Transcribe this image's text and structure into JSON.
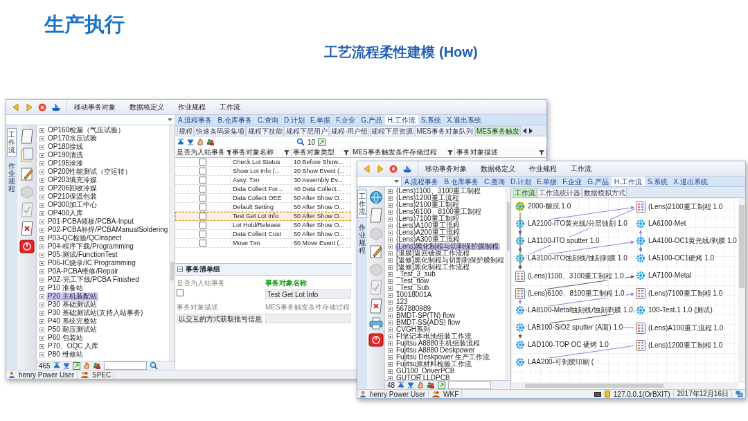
{
  "title": "生产执行",
  "subtitle": "工艺流程柔性建模 (How)",
  "windows": [
    {
      "kind": "spec",
      "menu": [
        "移动事务对象",
        "数据格定义",
        "作业规程",
        "工作流"
      ],
      "tabs": [
        {
          "label": "A.流程事务",
          "selected": false
        },
        {
          "label": "B.仓库事务",
          "selected": false
        },
        {
          "label": "C.查询",
          "selected": false
        },
        {
          "label": "D.计划",
          "selected": false
        },
        {
          "label": "E.单据",
          "selected": false
        },
        {
          "label": "F.企业",
          "selected": false
        },
        {
          "label": "G.产品",
          "selected": false
        },
        {
          "label": "H.工作流",
          "selected": true
        },
        {
          "label": "S.系统",
          "selected": false
        },
        {
          "label": "X.退出系统",
          "selected": false
        }
      ],
      "side_tabs": [
        {
          "label": "工作流",
          "selected": true
        },
        {
          "label": "作业规程",
          "selected": false
        }
      ],
      "tree": {
        "count": "465",
        "items": [
          {
            "label": "OP160检漏（气压试验）",
            "selected": false
          },
          {
            "label": "OP170水压试验",
            "selected": false
          },
          {
            "label": "OP180接线",
            "selected": false
          },
          {
            "label": "OP190清洗",
            "selected": false
          },
          {
            "label": "OP195涂漆",
            "selected": false
          },
          {
            "label": "OP200性能测试（空运转）",
            "selected": false
          },
          {
            "label": "OP203填充冷媒",
            "selected": false
          },
          {
            "label": "OP206回收冷媒",
            "selected": false
          },
          {
            "label": "OP210保温包装",
            "selected": false
          },
          {
            "label": "OP300加工中心",
            "selected": false
          },
          {
            "label": "OP400入库",
            "selected": false
          },
          {
            "label": "P01-PCBA领板/PCBA-Input",
            "selected": false
          },
          {
            "label": "P02-PCBA补焊/PCBAManualSoldering",
            "selected": false
          },
          {
            "label": "P03-QC检验/QCInspect",
            "selected": false
          },
          {
            "label": "P04-程序下载/Programming",
            "selected": false
          },
          {
            "label": "P05-测试/FunctionTest",
            "selected": false
          },
          {
            "label": "P06-IC烧录/IC Programming",
            "selected": false
          },
          {
            "label": "P0A-PCBA维修/Repair",
            "selected": false
          },
          {
            "label": "P0Z-完工下线/PCBA Finished",
            "selected": false
          },
          {
            "label": "P10 准备站",
            "selected": false
          },
          {
            "label": "P20 主机装配站",
            "selected": true
          },
          {
            "label": "P30 基础测试站",
            "selected": false
          },
          {
            "label": "P30 基础测试站(支持入站事务)",
            "selected": false
          },
          {
            "label": "P40 系统完整站",
            "selected": false
          },
          {
            "label": "P50 耐压测试站",
            "selected": false
          },
          {
            "label": "P60 包装站",
            "selected": false
          },
          {
            "label": "P70、OQC 入库",
            "selected": false
          },
          {
            "label": "P80 维修站",
            "selected": false
          }
        ]
      },
      "subtabs": [
        {
          "label": "规程",
          "selected": false
        },
        {
          "label": "快速条码采集项",
          "selected": false
        },
        {
          "label": "规程下技能",
          "selected": false
        },
        {
          "label": "规程下层用户",
          "selected": false
        },
        {
          "label": "规程-用户组",
          "selected": false
        },
        {
          "label": "规程下层资源",
          "selected": false
        },
        {
          "label": "MES事务对象队列",
          "selected": false
        },
        {
          "label": "MES事务触发",
          "selected": true
        }
      ],
      "page_size": "10",
      "table": {
        "columns": [
          "是否为入站事务",
          "事务对象名称",
          "事务对象类型",
          "MES事务触发条件存储过程",
          "事务对象描述"
        ],
        "rows": [
          {
            "inbound": false,
            "name": "Check Lot Status",
            "type": "10 Before Show...",
            "selected": false
          },
          {
            "inbound": false,
            "name": "Show Lot Info (...",
            "type": "20 Show Event (...",
            "selected": false
          },
          {
            "inbound": false,
            "name": "Assy. Txn",
            "type": "30 Assembly Ev...",
            "selected": false
          },
          {
            "inbound": false,
            "name": "Data Collect For...",
            "type": "40 Data Collect...",
            "selected": false
          },
          {
            "inbound": false,
            "name": "Data Collect OEE",
            "type": "50 After Show O...",
            "selected": false
          },
          {
            "inbound": false,
            "name": "Default Setting",
            "type": "50 After Show O...",
            "selected": false
          },
          {
            "inbound": false,
            "name": "Test Get Lot Info",
            "type": "50 After Show O...",
            "selected": true
          },
          {
            "inbound": false,
            "name": "Lot Hold/Release",
            "type": "50 After Show O...",
            "selected": false
          },
          {
            "inbound": false,
            "name": "Data Collect Cust",
            "type": "50 After Show O...",
            "selected": false
          },
          {
            "inbound": false,
            "name": "Move Txn",
            "type": "60 Move Event (...",
            "selected": false
          }
        ]
      },
      "detail": {
        "title": "事务清单组",
        "fields": [
          {
            "label": "是否为入站事务",
            "kind": "checkbox",
            "checked": false,
            "highlight": false
          },
          {
            "label": "事务对象名称",
            "kind": "text",
            "value": "Test Get Lot Info",
            "highlight": true
          },
          {
            "label": "事务对象描述",
            "kind": "text",
            "value": "以交互的方式获取批号信息",
            "highlight": false
          },
          {
            "label": "MES事务触发条件存储过程",
            "kind": "text",
            "highlight": false
          }
        ]
      },
      "status": {
        "user": "henry Power User",
        "module": "SPEC"
      }
    },
    {
      "kind": "flow",
      "menu": [
        "移动事务对象",
        "数据格定义",
        "作业规程",
        "工作流"
      ],
      "tabs": [
        {
          "label": "A.流程事务",
          "selected": false
        },
        {
          "label": "B.仓库事务",
          "selected": false
        },
        {
          "label": "C.查询",
          "selected": false
        },
        {
          "label": "D.计划",
          "selected": false
        },
        {
          "label": "E.单据",
          "selected": false
        },
        {
          "label": "F.企业",
          "selected": false
        },
        {
          "label": "G.产品",
          "selected": false
        },
        {
          "label": "H.工作流",
          "selected": true
        },
        {
          "label": "S.系统",
          "selected": false
        },
        {
          "label": "X.退出系统",
          "selected": false
        }
      ],
      "side_tabs": [
        {
          "label": "工作流",
          "selected": true
        },
        {
          "label": "作业规程",
          "selected": false
        }
      ],
      "tree": {
        "count": "48",
        "items": [
          {
            "label": "(Lens)1100、3100重工制程",
            "selected": false
          },
          {
            "label": "(Lens)1200重工流程",
            "selected": false
          },
          {
            "label": "(Lens)2100重工制程",
            "selected": false
          },
          {
            "label": "(Lens)6100、8100重工制程",
            "selected": false
          },
          {
            "label": "(Lens)7100重工制程",
            "selected": false
          },
          {
            "label": "(Lens)A100重工流程",
            "selected": false
          },
          {
            "label": "(Lens)A200重工流程",
            "selected": false
          },
          {
            "label": "(Lens)A300重工流程",
            "selected": false
          },
          {
            "label": "(Lens)黑化制程与切剥保护膜制程",
            "selected": true
          },
          {
            "label": "[退膜]返回镀膜工作流程",
            "selected": false
          },
          {
            "label": "[返修]黑化制程与切割剥保护膜制程",
            "selected": false
          },
          {
            "label": "[返修]黑化制程工作流程",
            "selected": false
          },
          {
            "label": "_Test_3_sub",
            "selected": false
          },
          {
            "label": "_Test_flow",
            "selected": false
          },
          {
            "label": "_Test_Sub",
            "selected": false
          },
          {
            "label": "10018001A",
            "selected": false
          },
          {
            "label": "123",
            "selected": false
          },
          {
            "label": "567880989",
            "selected": false
          },
          {
            "label": "BMDT-SP(TN) flow",
            "selected": false
          },
          {
            "label": "BMDT-SS(ADS) flow",
            "selected": false
          },
          {
            "label": "CVGH系列",
            "selected": false
          },
          {
            "label": "FI笔记本电池组装工作流",
            "selected": false
          },
          {
            "label": "Fujitsu A8880主机组装流程",
            "selected": false
          },
          {
            "label": "Fujitsu A8880 Deskpower",
            "selected": false
          },
          {
            "label": "Fujitsu Deskpower 生产工作流",
            "selected": false
          },
          {
            "label": "Fujitsu原材料检验工作流",
            "selected": false
          },
          {
            "label": "GU100_DriverPCB",
            "selected": false
          },
          {
            "label": "GUTOR LLDPCB",
            "selected": false
          }
        ]
      },
      "subtabs": [
        {
          "label": "工作流",
          "selected": true
        },
        {
          "label": "工作流统计器",
          "selected": false
        },
        {
          "label": "数据模拟方式",
          "selected": false
        }
      ],
      "graph": {
        "nodes": [
          {
            "kind": "step",
            "label": "2000-酸洗 1.0",
            "selected": true
          },
          {
            "kind": "document",
            "label": "(Lens)2100重工制程 1.0",
            "selected": false
          },
          {
            "kind": "step",
            "label": "LA2100-ITO黄光线/分层蚀刻 1.0",
            "selected": false
          },
          {
            "kind": "step",
            "label": "LA6100-Met",
            "selected": false
          },
          {
            "kind": "step",
            "label": "LA1100-ITO sputter 1.0",
            "selected": false
          },
          {
            "kind": "step",
            "label": "LA4100-OC1黄光线/剥膜 1.0",
            "selected": false
          },
          {
            "kind": "step",
            "label": "LA3100-ITO蚀刻线/蚀刻剥膜 1.0",
            "selected": false
          },
          {
            "kind": "step",
            "label": "LA5100-OC1硬烤 1.0",
            "selected": false
          },
          {
            "kind": "document",
            "label": "(Lens)1100、3100重工制程 1.0",
            "selected": false
          },
          {
            "kind": "step",
            "label": "LA7100-Metal",
            "selected": false
          },
          {
            "kind": "document",
            "label": "(Lens)6100、8100重工制程 1.0",
            "selected": false
          },
          {
            "kind": "document",
            "label": "(Lens)7100重工制程 1.0",
            "selected": false
          },
          {
            "kind": "step",
            "label": "LA8100-Metal蚀刻线/蚀刻剥膜 1.0",
            "selected": false
          },
          {
            "kind": "step",
            "label": "100-Test.1 1.0 (测试)",
            "selected": false
          },
          {
            "kind": "step",
            "label": "LAB100-SiO2 sputter (A面) 1.0",
            "selected": false
          },
          {
            "kind": "document",
            "label": "(Lens)A100重工流程 1.0",
            "selected": false
          },
          {
            "kind": "step",
            "label": "LAD100-TOP OC 硬烤 1.0",
            "selected": false
          },
          {
            "kind": "document",
            "label": "(Lens)1200重工制程 1.0",
            "selected": false
          },
          {
            "kind": "step",
            "label": "LAA200-可剥胶印刷 (",
            "selected": false
          }
        ]
      },
      "status": {
        "user": "henry Power User",
        "module": "WKF",
        "server": "127.0.0.1(OrBXIT)",
        "date": "2017年12月16日"
      }
    }
  ]
}
